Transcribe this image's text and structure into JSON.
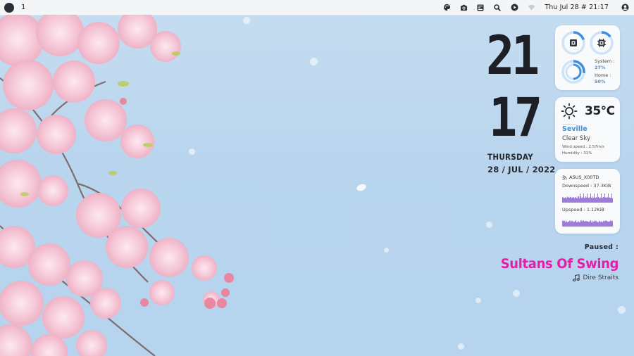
{
  "topbar": {
    "workspace": "1",
    "clock": "Thu Jul 28 # 21:17",
    "icons": [
      "palette-icon",
      "screenshot-icon",
      "file-manager-icon",
      "search-icon",
      "media-play-icon",
      "wifi-icon",
      "user-icon"
    ]
  },
  "clock": {
    "hour": "21",
    "minute": "17",
    "day": "THURSDAY",
    "date": "28 / JUL / 2022"
  },
  "system": {
    "system_label": "System :",
    "system_value": "27%",
    "system_percent": 27,
    "home_label": "Home :",
    "home_value": "50%",
    "home_percent": 50,
    "cpu_percent": 15,
    "ram_percent": 20,
    "icons": [
      "memory-icon",
      "cpu-icon",
      "disk-icon"
    ]
  },
  "weather": {
    "temperature": "35°C",
    "dots": "..............",
    "city": "Seville",
    "condition": "Clear Sky",
    "wind": "Wind speed : 2.57m/s",
    "humidity": "Humidity : 31%",
    "icon": "sun-icon"
  },
  "network": {
    "ssid": "ASUS_X00TD",
    "down_label": "Downspeed : 37.3KiB",
    "up_label": "Upspeed : 1.12KiB"
  },
  "music": {
    "status": "Paused :",
    "title": "Sultans Of Swing",
    "artist": "Dire Straits"
  },
  "colors": {
    "accent_blue": "#3d8fe0",
    "accent_pink": "#ea1aa8",
    "graph_start": "#e11fbf",
    "graph_end": "#3a8fe0"
  }
}
